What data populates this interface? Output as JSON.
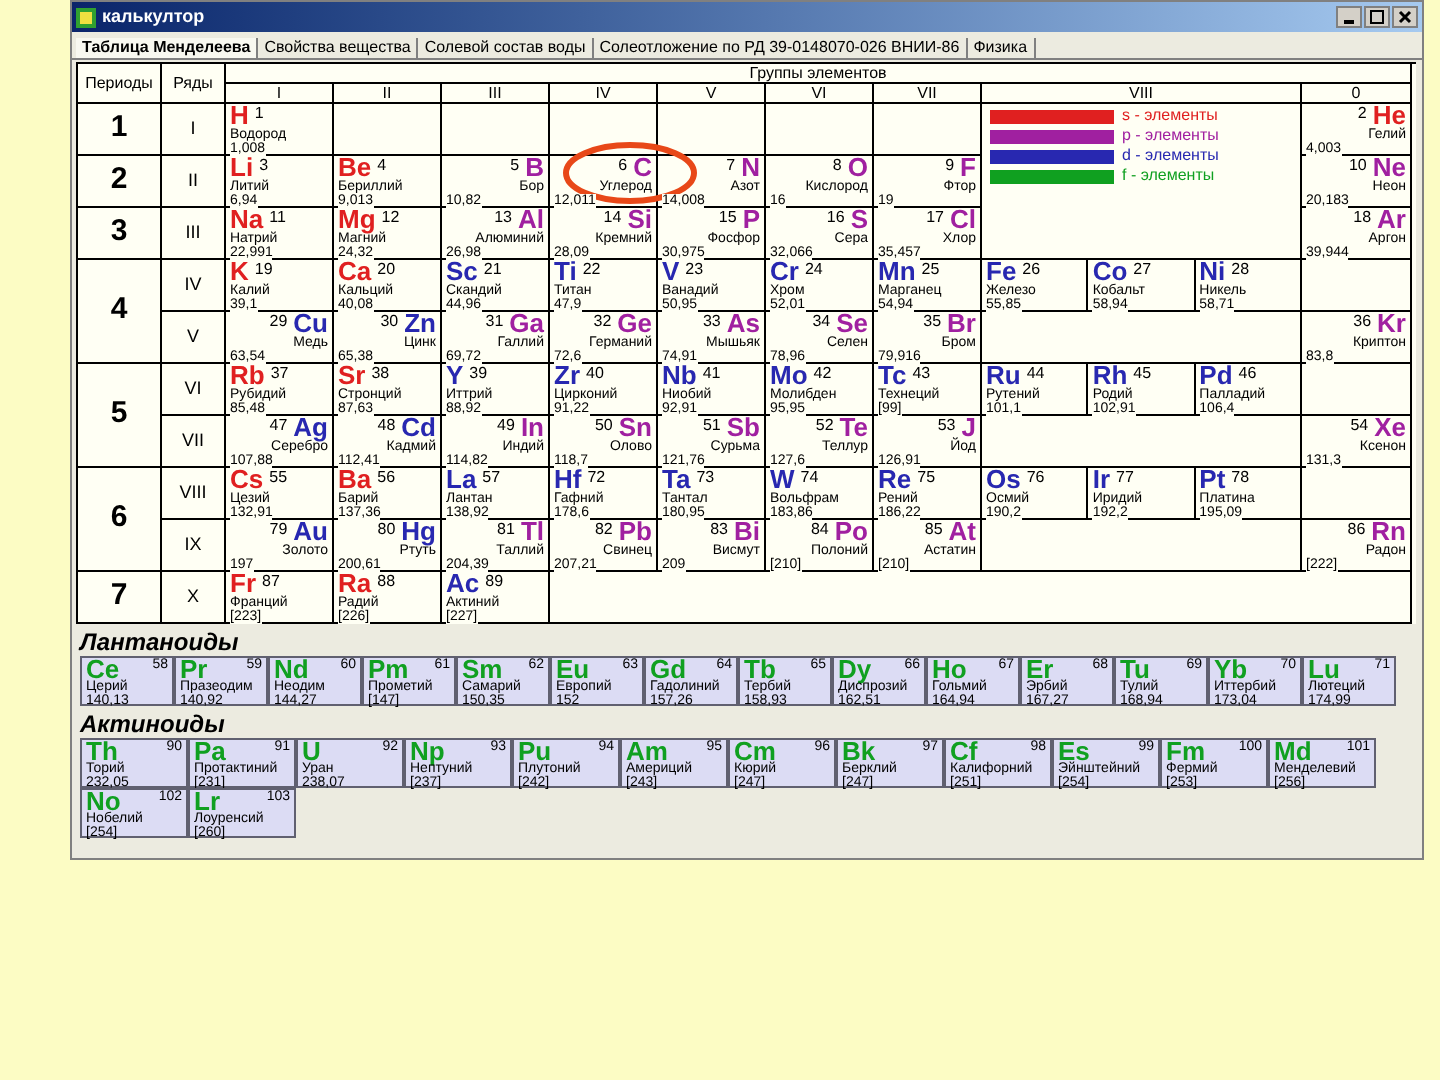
{
  "window": {
    "title": "калькултор"
  },
  "tabs": [
    {
      "label": "Таблица Менделеева",
      "selected": true
    },
    {
      "label": "Свойства вещества",
      "selected": false
    },
    {
      "label": "Солевой состав воды",
      "selected": false
    },
    {
      "label": "Солеотложение по РД 39-0148070-026 ВНИИ-86",
      "selected": false
    },
    {
      "label": "Физика",
      "selected": false
    }
  ],
  "table": {
    "periods_header": "Периоды",
    "series_header": "Ряды",
    "groups_title": "Группы элементов",
    "groups": [
      "I",
      "II",
      "III",
      "IV",
      "V",
      "VI",
      "VII",
      "VIII",
      "0"
    ],
    "periods": [
      {
        "label": "1",
        "series": [
          {
            "label": "I",
            "cells": [
              {
                "kind": "element",
                "symbol": "H",
                "number": "1",
                "name": "Водород",
                "mass": "1,008",
                "color": "#e02020",
                "circled": false
              },
              {
                "kind": "empty"
              },
              {
                "kind": "empty"
              },
              {
                "kind": "empty"
              },
              {
                "kind": "empty"
              },
              {
                "kind": "empty"
              },
              {
                "kind": "empty"
              },
              {
                "kind": "legend",
                "items": [
                  {
                    "label": "s - элементы",
                    "color": "#e02020"
                  },
                  {
                    "label": "p - элементы",
                    "color": "#a020a0"
                  },
                  {
                    "label": "d - элементы",
                    "color": "#2828b0"
                  },
                  {
                    "label": "f - элементы",
                    "color": "#10a020"
                  }
                ]
              },
              {
                "kind": "element",
                "symbol": "He",
                "number": "2",
                "name": "Гелий",
                "mass": "4,003",
                "color": "#e02020",
                "circled": false
              }
            ]
          }
        ]
      },
      {
        "label": "2",
        "series": [
          {
            "label": "II",
            "cells": [
              {
                "kind": "element",
                "symbol": "Li",
                "number": "3",
                "name": "Литий",
                "mass": "6,94",
                "color": "#e02020",
                "circled": false
              },
              {
                "kind": "element",
                "symbol": "Be",
                "number": "4",
                "name": "Бериллий",
                "mass": "9,013",
                "color": "#e02020",
                "circled": false
              },
              {
                "kind": "element",
                "symbol": "B",
                "number": "5",
                "name": "Бор",
                "mass": "10,82",
                "color": "#a020a0",
                "circled": false
              },
              {
                "kind": "element",
                "symbol": "C",
                "number": "6",
                "name": "Углерод",
                "mass": "12,011",
                "color": "#a020a0",
                "circled": true
              },
              {
                "kind": "element",
                "symbol": "N",
                "number": "7",
                "name": "Азот",
                "mass": "14,008",
                "color": "#a020a0",
                "circled": false
              },
              {
                "kind": "element",
                "symbol": "O",
                "number": "8",
                "name": "Кислород",
                "mass": "16",
                "color": "#a020a0",
                "circled": false
              },
              {
                "kind": "element",
                "symbol": "F",
                "number": "9",
                "name": "Фтор",
                "mass": "19",
                "color": "#a020a0",
                "circled": false
              },
              {
                "kind": "element",
                "symbol": "Ne",
                "number": "10",
                "name": "Неон",
                "mass": "20,183",
                "color": "#a020a0",
                "circled": false
              }
            ]
          }
        ]
      },
      {
        "label": "3",
        "series": [
          {
            "label": "III",
            "cells": [
              {
                "kind": "element",
                "symbol": "Na",
                "number": "11",
                "name": "Натрий",
                "mass": "22,991",
                "color": "#e02020",
                "circled": false
              },
              {
                "kind": "element",
                "symbol": "Mg",
                "number": "12",
                "name": "Магний",
                "mass": "24,32",
                "color": "#e02020",
                "circled": false
              },
              {
                "kind": "element",
                "symbol": "Al",
                "number": "13",
                "name": "Алюминий",
                "mass": "26,98",
                "color": "#a020a0",
                "circled": false
              },
              {
                "kind": "element",
                "symbol": "Si",
                "number": "14",
                "name": "Кремний",
                "mass": "28,09",
                "color": "#a020a0",
                "circled": false
              },
              {
                "kind": "element",
                "symbol": "P",
                "number": "15",
                "name": "Фосфор",
                "mass": "30,975",
                "color": "#a020a0",
                "circled": false
              },
              {
                "kind": "element",
                "symbol": "S",
                "number": "16",
                "name": "Сера",
                "mass": "32,066",
                "color": "#a020a0",
                "circled": false
              },
              {
                "kind": "element",
                "symbol": "Cl",
                "number": "17",
                "name": "Хлор",
                "mass": "35,457",
                "color": "#a020a0",
                "circled": false
              },
              {
                "kind": "element",
                "symbol": "Ar",
                "number": "18",
                "name": "Аргон",
                "mass": "39,944",
                "color": "#a020a0",
                "circled": false
              }
            ]
          }
        ]
      },
      {
        "label": "4",
        "series": [
          {
            "label": "IV",
            "cells": [
              {
                "kind": "element",
                "symbol": "K",
                "number": "19",
                "name": "Калий",
                "mass": "39,1",
                "color": "#e02020",
                "circled": false
              },
              {
                "kind": "element",
                "symbol": "Ca",
                "number": "20",
                "name": "Кальций",
                "mass": "40,08",
                "color": "#e02020",
                "circled": false
              },
              {
                "kind": "element",
                "symbol": "Sc",
                "number": "21",
                "name": "Скандий",
                "mass": "44,96",
                "color": "#2828b0",
                "circled": false
              },
              {
                "kind": "element",
                "symbol": "Ti",
                "number": "22",
                "name": "Титан",
                "mass": "47,9",
                "color": "#2828b0",
                "circled": false
              },
              {
                "kind": "element",
                "symbol": "V",
                "number": "23",
                "name": "Ванадий",
                "mass": "50,95",
                "color": "#2828b0",
                "circled": false
              },
              {
                "kind": "element",
                "symbol": "Cr",
                "number": "24",
                "name": "Хром",
                "mass": "52,01",
                "color": "#2828b0",
                "circled": false
              },
              {
                "kind": "element",
                "symbol": "Mn",
                "number": "25",
                "name": "Марганец",
                "mass": "54,94",
                "color": "#2828b0",
                "circled": false
              },
              {
                "kind": "triad",
                "elements": [
                  {
                    "symbol": "Fe",
                    "number": "26",
                    "name": "Железо",
                    "mass": "55,85",
                    "color": "#2828b0",
                    "circled": false
                  },
                  {
                    "symbol": "Co",
                    "number": "27",
                    "name": "Кобальт",
                    "mass": "58,94",
                    "color": "#2828b0",
                    "circled": false
                  },
                  {
                    "symbol": "Ni",
                    "number": "28",
                    "name": "Никель",
                    "mass": "58,71",
                    "color": "#2828b0",
                    "circled": false
                  }
                ]
              },
              {
                "kind": "empty"
              }
            ]
          },
          {
            "label": "V",
            "cells": [
              {
                "kind": "element",
                "symbol": "Cu",
                "number": "29",
                "name": "Медь",
                "mass": "63,54",
                "color": "#2828b0",
                "circled": false
              },
              {
                "kind": "element",
                "symbol": "Zn",
                "number": "30",
                "name": "Цинк",
                "mass": "65,38",
                "color": "#2828b0",
                "circled": false
              },
              {
                "kind": "element",
                "symbol": "Ga",
                "number": "31",
                "name": "Галлий",
                "mass": "69,72",
                "color": "#a020a0",
                "circled": false
              },
              {
                "kind": "element",
                "symbol": "Ge",
                "number": "32",
                "name": "Германий",
                "mass": "72,6",
                "color": "#a020a0",
                "circled": false
              },
              {
                "kind": "element",
                "symbol": "As",
                "number": "33",
                "name": "Мышьяк",
                "mass": "74,91",
                "color": "#a020a0",
                "circled": false
              },
              {
                "kind": "element",
                "symbol": "Se",
                "number": "34",
                "name": "Селен",
                "mass": "78,96",
                "color": "#a020a0",
                "circled": false
              },
              {
                "kind": "element",
                "symbol": "Br",
                "number": "35",
                "name": "Бром",
                "mass": "79,916",
                "color": "#a020a0",
                "circled": false
              },
              {
                "kind": "empty"
              },
              {
                "kind": "element",
                "symbol": "Kr",
                "number": "36",
                "name": "Криптон",
                "mass": "83,8",
                "color": "#a020a0",
                "circled": false
              }
            ]
          }
        ]
      },
      {
        "label": "5",
        "series": [
          {
            "label": "VI",
            "cells": [
              {
                "kind": "element",
                "symbol": "Rb",
                "number": "37",
                "name": "Рубидий",
                "mass": "85,48",
                "color": "#e02020",
                "circled": false
              },
              {
                "kind": "element",
                "symbol": "Sr",
                "number": "38",
                "name": "Стронций",
                "mass": "87,63",
                "color": "#e02020",
                "circled": false
              },
              {
                "kind": "element",
                "symbol": "Y",
                "number": "39",
                "name": "Иттрий",
                "mass": "88,92",
                "color": "#2828b0",
                "circled": false
              },
              {
                "kind": "element",
                "symbol": "Zr",
                "number": "40",
                "name": "Цирконий",
                "mass": "91,22",
                "color": "#2828b0",
                "circled": false
              },
              {
                "kind": "element",
                "symbol": "Nb",
                "number": "41",
                "name": "Ниобий",
                "mass": "92,91",
                "color": "#2828b0",
                "circled": false
              },
              {
                "kind": "element",
                "symbol": "Mo",
                "number": "42",
                "name": "Молибден",
                "mass": "95,95",
                "color": "#2828b0",
                "circled": false
              },
              {
                "kind": "element",
                "symbol": "Tc",
                "number": "43",
                "name": "Технеций",
                "mass": "[99]",
                "color": "#2828b0",
                "circled": false
              },
              {
                "kind": "triad",
                "elements": [
                  {
                    "symbol": "Ru",
                    "number": "44",
                    "name": "Рутений",
                    "mass": "101,1",
                    "color": "#2828b0",
                    "circled": false
                  },
                  {
                    "symbol": "Rh",
                    "number": "45",
                    "name": "Родий",
                    "mass": "102,91",
                    "color": "#2828b0",
                    "circled": false
                  },
                  {
                    "symbol": "Pd",
                    "number": "46",
                    "name": "Палладий",
                    "mass": "106,4",
                    "color": "#2828b0",
                    "circled": false
                  }
                ]
              },
              {
                "kind": "empty"
              }
            ]
          },
          {
            "label": "VII",
            "cells": [
              {
                "kind": "element",
                "symbol": "Ag",
                "number": "47",
                "name": "Серебро",
                "mass": "107,88",
                "color": "#2828b0",
                "circled": false
              },
              {
                "kind": "element",
                "symbol": "Cd",
                "number": "48",
                "name": "Кадмий",
                "mass": "112,41",
                "color": "#2828b0",
                "circled": false
              },
              {
                "kind": "element",
                "symbol": "In",
                "number": "49",
                "name": "Индий",
                "mass": "114,82",
                "color": "#a020a0",
                "circled": false
              },
              {
                "kind": "element",
                "symbol": "Sn",
                "number": "50",
                "name": "Олово",
                "mass": "118,7",
                "color": "#a020a0",
                "circled": false
              },
              {
                "kind": "element",
                "symbol": "Sb",
                "number": "51",
                "name": "Сурьма",
                "mass": "121,76",
                "color": "#a020a0",
                "circled": false
              },
              {
                "kind": "element",
                "symbol": "Te",
                "number": "52",
                "name": "Теллур",
                "mass": "127,6",
                "color": "#a020a0",
                "circled": false
              },
              {
                "kind": "element",
                "symbol": "J",
                "number": "53",
                "name": "Йод",
                "mass": "126,91",
                "color": "#a020a0",
                "circled": false
              },
              {
                "kind": "empty"
              },
              {
                "kind": "element",
                "symbol": "Xe",
                "number": "54",
                "name": "Ксенон",
                "mass": "131,3",
                "color": "#a020a0",
                "circled": false
              }
            ]
          }
        ]
      },
      {
        "label": "6",
        "series": [
          {
            "label": "VIII",
            "cells": [
              {
                "kind": "element",
                "symbol": "Cs",
                "number": "55",
                "name": "Цезий",
                "mass": "132,91",
                "color": "#e02020",
                "circled": false
              },
              {
                "kind": "element",
                "symbol": "Ba",
                "number": "56",
                "name": "Барий",
                "mass": "137,36",
                "color": "#e02020",
                "circled": false
              },
              {
                "kind": "element",
                "symbol": "La",
                "number": "57",
                "name": "Лантан",
                "mass": "138,92",
                "color": "#2828b0",
                "circled": false
              },
              {
                "kind": "element",
                "symbol": "Hf",
                "number": "72",
                "name": "Гафний",
                "mass": "178,6",
                "color": "#2828b0",
                "circled": false
              },
              {
                "kind": "element",
                "symbol": "Ta",
                "number": "73",
                "name": "Тантал",
                "mass": "180,95",
                "color": "#2828b0",
                "circled": false
              },
              {
                "kind": "element",
                "symbol": "W",
                "number": "74",
                "name": "Вольфрам",
                "mass": "183,86",
                "color": "#2828b0",
                "circled": false
              },
              {
                "kind": "element",
                "symbol": "Re",
                "number": "75",
                "name": "Рений",
                "mass": "186,22",
                "color": "#2828b0",
                "circled": false
              },
              {
                "kind": "triad",
                "elements": [
                  {
                    "symbol": "Os",
                    "number": "76",
                    "name": "Осмий",
                    "mass": "190,2",
                    "color": "#2828b0",
                    "circled": false
                  },
                  {
                    "symbol": "Ir",
                    "number": "77",
                    "name": "Иридий",
                    "mass": "192,2",
                    "color": "#2828b0",
                    "circled": false
                  },
                  {
                    "symbol": "Pt",
                    "number": "78",
                    "name": "Платина",
                    "mass": "195,09",
                    "color": "#2828b0",
                    "circled": false
                  }
                ]
              },
              {
                "kind": "empty"
              }
            ]
          },
          {
            "label": "IX",
            "cells": [
              {
                "kind": "element",
                "symbol": "Au",
                "number": "79",
                "name": "Золото",
                "mass": "197",
                "color": "#2828b0",
                "circled": false
              },
              {
                "kind": "element",
                "symbol": "Hg",
                "number": "80",
                "name": "Ртуть",
                "mass": "200,61",
                "color": "#2828b0",
                "circled": false
              },
              {
                "kind": "element",
                "symbol": "Tl",
                "number": "81",
                "name": "Таллий",
                "mass": "204,39",
                "color": "#a020a0",
                "circled": false
              },
              {
                "kind": "element",
                "symbol": "Pb",
                "number": "82",
                "name": "Свинец",
                "mass": "207,21",
                "color": "#a020a0",
                "circled": false
              },
              {
                "kind": "element",
                "symbol": "Bi",
                "number": "83",
                "name": "Висмут",
                "mass": "209",
                "color": "#a020a0",
                "circled": false
              },
              {
                "kind": "element",
                "symbol": "Po",
                "number": "84",
                "name": "Полоний",
                "mass": "[210]",
                "color": "#a020a0",
                "circled": false
              },
              {
                "kind": "element",
                "symbol": "At",
                "number": "85",
                "name": "Астатин",
                "mass": "[210]",
                "color": "#a020a0",
                "circled": false
              },
              {
                "kind": "empty"
              },
              {
                "kind": "element",
                "symbol": "Rn",
                "number": "86",
                "name": "Радон",
                "mass": "[222]",
                "color": "#a020a0",
                "circled": false
              }
            ]
          }
        ]
      },
      {
        "label": "7",
        "series": [
          {
            "label": "X",
            "cells": [
              {
                "kind": "element",
                "symbol": "Fr",
                "number": "87",
                "name": "Франций",
                "mass": "[223]",
                "color": "#e02020",
                "circled": false
              },
              {
                "kind": "element",
                "symbol": "Ra",
                "number": "88",
                "name": "Радий",
                "mass": "[226]",
                "color": "#e02020",
                "circled": false
              },
              {
                "kind": "element",
                "symbol": "Ac",
                "number": "89",
                "name": "Актиний",
                "mass": "[227]",
                "color": "#2828b0",
                "circled": false
              },
              {
                "kind": "empty"
              }
            ]
          }
        ]
      }
    ]
  },
  "lanthanides": {
    "title": "Лантаноиды",
    "elements": [
      {
        "symbol": "Ce",
        "number": "58",
        "name": "Церий",
        "mass": "140,13",
        "color": "#10a020"
      },
      {
        "symbol": "Pr",
        "number": "59",
        "name": "Празеодим",
        "mass": "140,92",
        "color": "#10a020"
      },
      {
        "symbol": "Nd",
        "number": "60",
        "name": "Неодим",
        "mass": "144,27",
        "color": "#10a020"
      },
      {
        "symbol": "Pm",
        "number": "61",
        "name": "Прометий",
        "mass": "[147]",
        "color": "#10a020"
      },
      {
        "symbol": "Sm",
        "number": "62",
        "name": "Самарий",
        "mass": "150,35",
        "color": "#10a020"
      },
      {
        "symbol": "Eu",
        "number": "63",
        "name": "Европий",
        "mass": "152",
        "color": "#10a020"
      },
      {
        "symbol": "Gd",
        "number": "64",
        "name": "Гадолиний",
        "mass": "157,26",
        "color": "#10a020"
      },
      {
        "symbol": "Tb",
        "number": "65",
        "name": "Тербий",
        "mass": "158,93",
        "color": "#10a020"
      },
      {
        "symbol": "Dy",
        "number": "66",
        "name": "Диспрозий",
        "mass": "162,51",
        "color": "#10a020"
      },
      {
        "symbol": "Ho",
        "number": "67",
        "name": "Гольмий",
        "mass": "164,94",
        "color": "#10a020"
      },
      {
        "symbol": "Er",
        "number": "68",
        "name": "Эрбий",
        "mass": "167,27",
        "color": "#10a020"
      },
      {
        "symbol": "Tu",
        "number": "69",
        "name": "Тулий",
        "mass": "168,94",
        "color": "#10a020"
      },
      {
        "symbol": "Yb",
        "number": "70",
        "name": "Иттербий",
        "mass": "173,04",
        "color": "#10a020"
      },
      {
        "symbol": "Lu",
        "number": "71",
        "name": "Лютеций",
        "mass": "174,99",
        "color": "#10a020"
      }
    ]
  },
  "actinides": {
    "title": "Актиноиды",
    "elements": [
      {
        "symbol": "Th",
        "number": "90",
        "name": "Торий",
        "mass": "232,05",
        "color": "#10a020"
      },
      {
        "symbol": "Pa",
        "number": "91",
        "name": "Протактиний",
        "mass": "[231]",
        "color": "#10a020"
      },
      {
        "symbol": "U",
        "number": "92",
        "name": "Уран",
        "mass": "238,07",
        "color": "#10a020"
      },
      {
        "symbol": "Np",
        "number": "93",
        "name": "Нептуний",
        "mass": "[237]",
        "color": "#10a020"
      },
      {
        "symbol": "Pu",
        "number": "94",
        "name": "Плутоний",
        "mass": "[242]",
        "color": "#10a020"
      },
      {
        "symbol": "Am",
        "number": "95",
        "name": "Америций",
        "mass": "[243]",
        "color": "#10a020"
      },
      {
        "symbol": "Cm",
        "number": "96",
        "name": "Кюрий",
        "mass": "[247]",
        "color": "#10a020"
      },
      {
        "symbol": "Bk",
        "number": "97",
        "name": "Берклий",
        "mass": "[247]",
        "color": "#10a020"
      },
      {
        "symbol": "Cf",
        "number": "98",
        "name": "Калифорний",
        "mass": "[251]",
        "color": "#10a020"
      },
      {
        "symbol": "Es",
        "number": "99",
        "name": "Эйнштейний",
        "mass": "[254]",
        "color": "#10a020"
      },
      {
        "symbol": "Fm",
        "number": "100",
        "name": "Фермий",
        "mass": "[253]",
        "color": "#10a020"
      },
      {
        "symbol": "Md",
        "number": "101",
        "name": "Менделевий",
        "mass": "[256]",
        "color": "#10a020"
      },
      {
        "symbol": "No",
        "number": "102",
        "name": "Нобелий",
        "mass": "[254]",
        "color": "#10a020"
      },
      {
        "symbol": "Lr",
        "number": "103",
        "name": "Лоуренсий",
        "mass": "[260]",
        "color": "#10a020"
      }
    ]
  }
}
